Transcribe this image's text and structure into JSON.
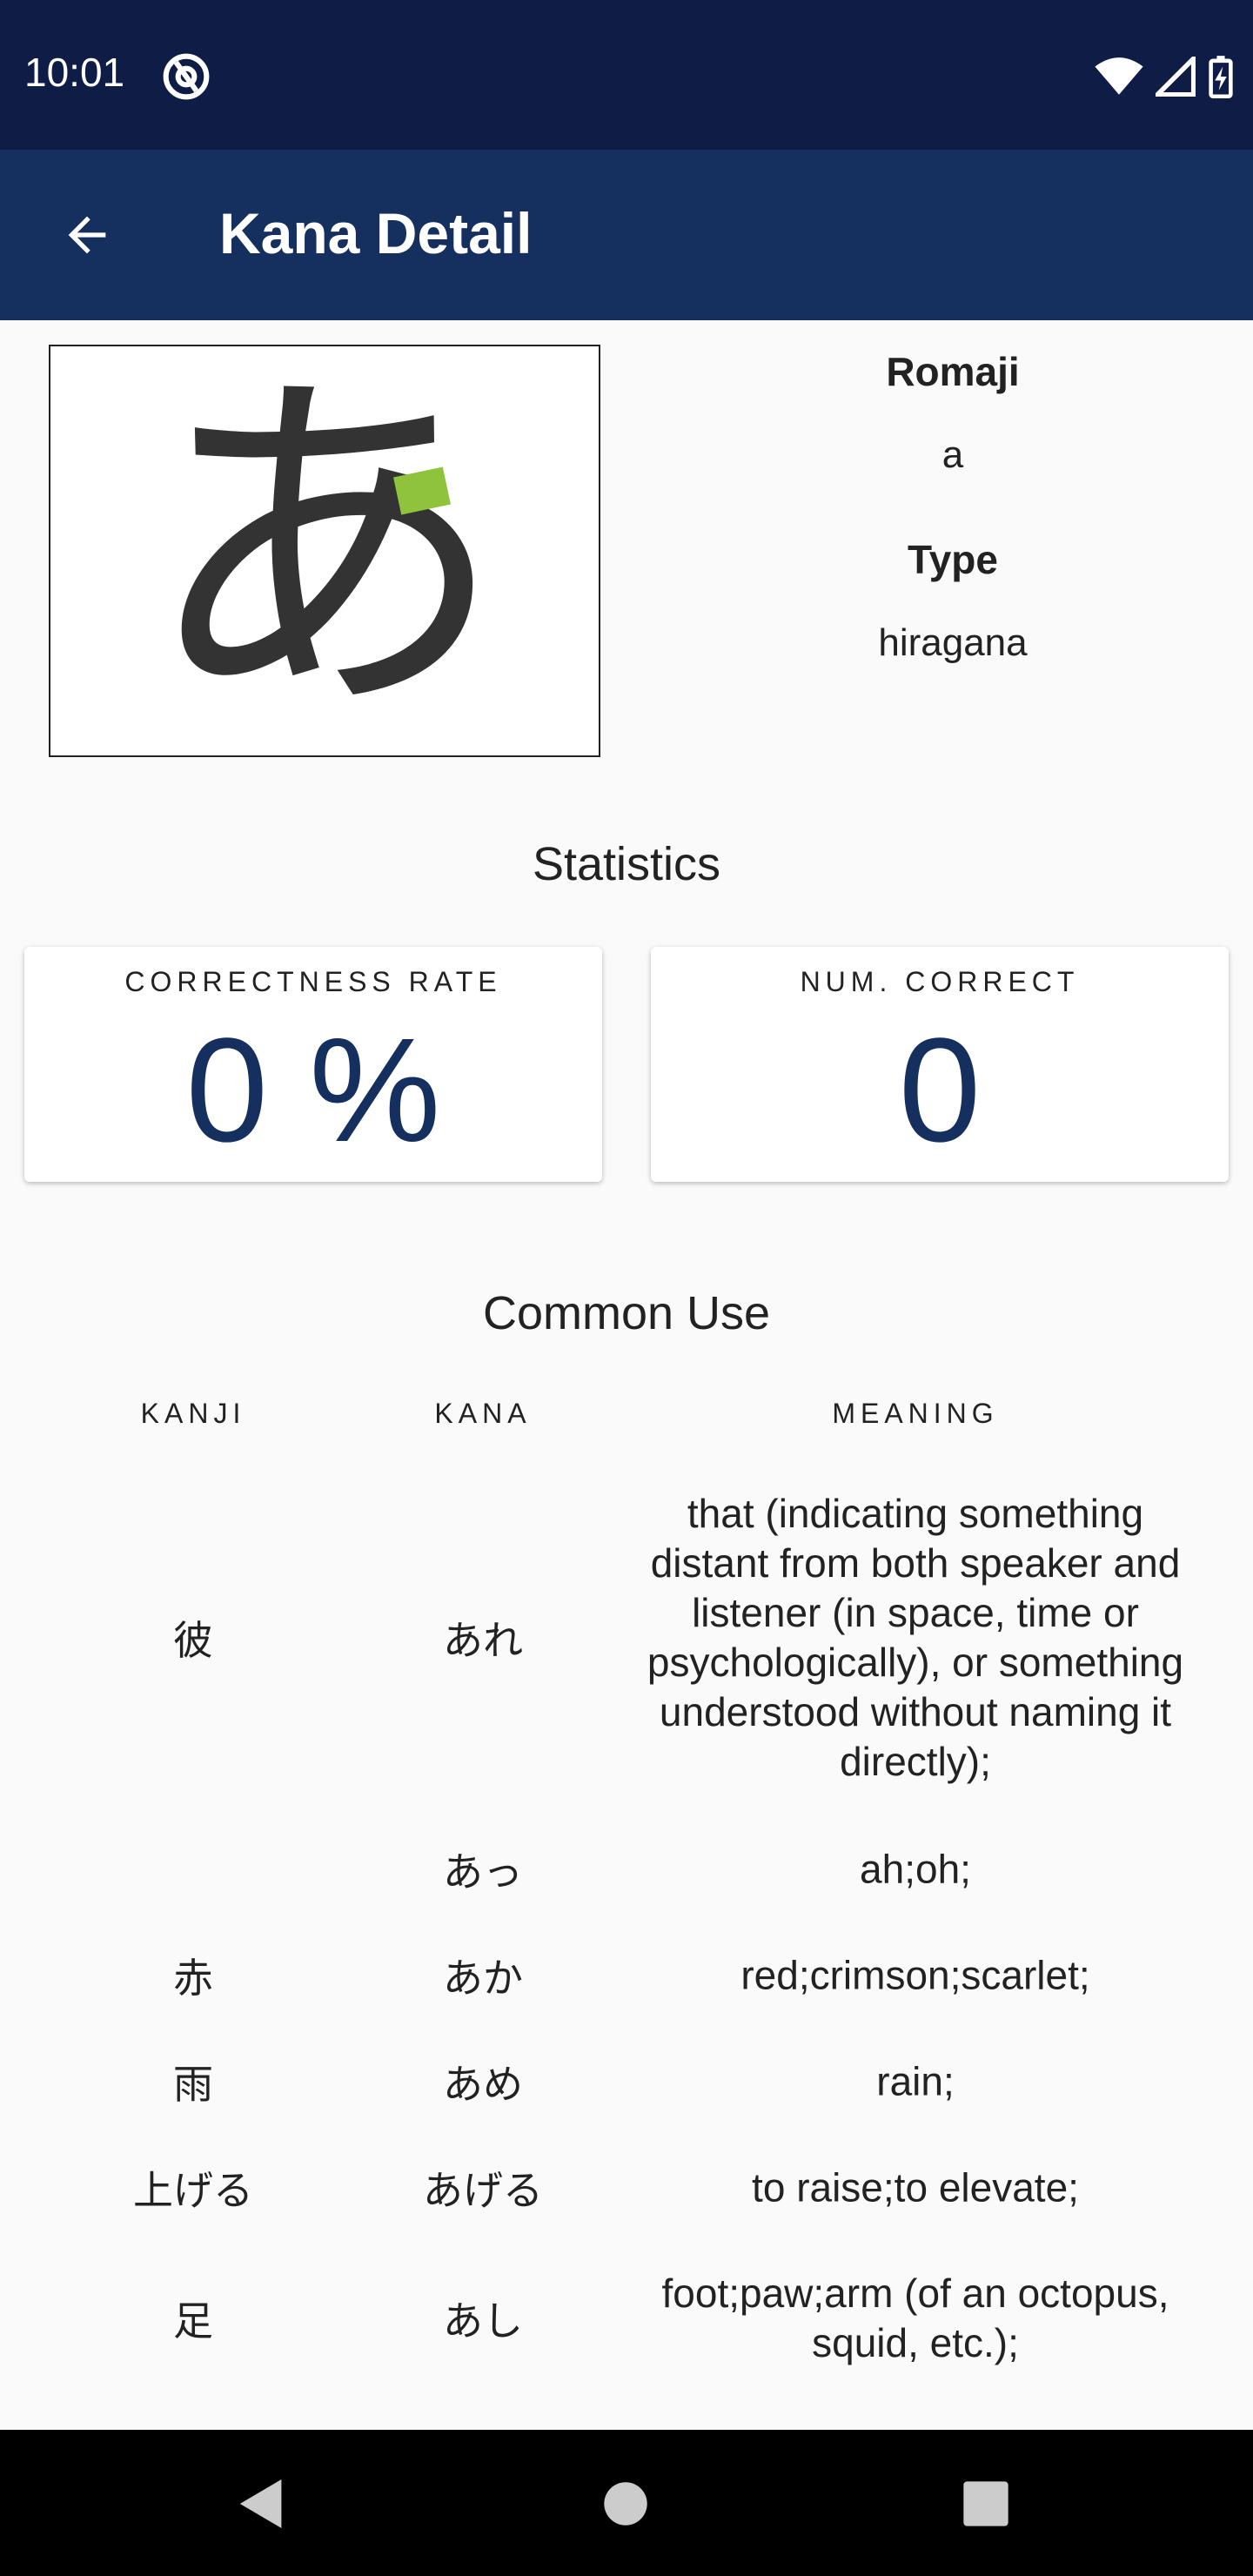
{
  "status_bar": {
    "time": "10:01"
  },
  "app_bar": {
    "title": "Kana Detail"
  },
  "kana": {
    "character": "あ"
  },
  "info": {
    "romaji_label": "Romaji",
    "romaji_value": "a",
    "type_label": "Type",
    "type_value": "hiragana"
  },
  "statistics": {
    "title": "Statistics",
    "correctness_label": "CORRECTNESS RATE",
    "correctness_value": "0 %",
    "num_correct_label": "NUM. CORRECT",
    "num_correct_value": "0"
  },
  "common_use": {
    "title": "Common Use",
    "headers": {
      "kanji": "KANJI",
      "kana": "KANA",
      "meaning": "MEANING"
    },
    "rows": [
      {
        "kanji": "彼",
        "kana": "あれ",
        "meaning": "that (indicating something distant from both speaker and listener (in space, time or psychologically), or something understood without naming it directly);"
      },
      {
        "kanji": "",
        "kana": "あっ",
        "meaning": "ah;oh;"
      },
      {
        "kanji": "赤",
        "kana": "あか",
        "meaning": "red;crimson;scarlet;"
      },
      {
        "kanji": "雨",
        "kana": "あめ",
        "meaning": "rain;"
      },
      {
        "kanji": "上げる",
        "kana": "あげる",
        "meaning": "to raise;to elevate;"
      },
      {
        "kanji": "足",
        "kana": "あし",
        "meaning": "foot;paw;arm (of an octopus, squid, etc.);"
      }
    ]
  },
  "colors": {
    "status_bar": "#0f1c46",
    "app_bar": "#15305f",
    "accent": "#15305f",
    "stroke_hint": "#8fc33b"
  },
  "icons": {
    "back": "arrow-left-icon",
    "status_at": "at-sign-icon",
    "wifi": "wifi-icon",
    "signal": "signal-icon",
    "battery": "battery-charging-icon",
    "nav_back": "triangle-back-icon",
    "nav_home": "circle-home-icon",
    "nav_recents": "square-recents-icon"
  }
}
